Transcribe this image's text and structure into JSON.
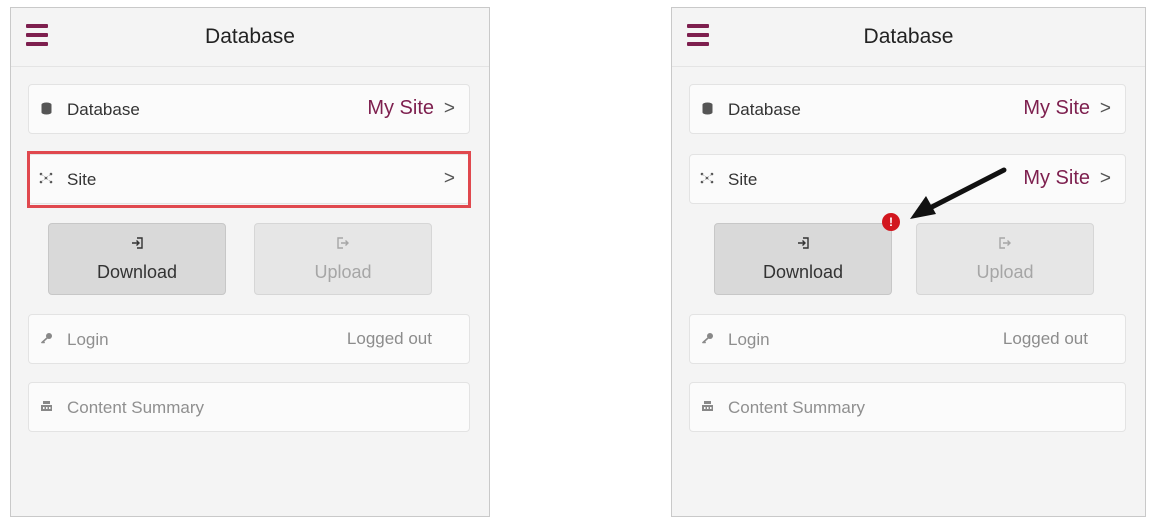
{
  "screens": [
    {
      "header": {
        "title": "Database"
      },
      "database_row": {
        "icon": "database-icon",
        "label": "Database",
        "value": "My Site"
      },
      "site_row": {
        "icon": "site-icon",
        "label": "Site",
        "value": ""
      },
      "download_button": {
        "icon": "download-icon",
        "label": "Download"
      },
      "upload_button": {
        "icon": "upload-icon",
        "label": "Upload"
      },
      "login_row": {
        "icon": "key-icon",
        "label": "Login",
        "value": "Logged out"
      },
      "summary_row": {
        "icon": "summary-icon",
        "label": "Content Summary"
      }
    },
    {
      "header": {
        "title": "Database"
      },
      "database_row": {
        "icon": "database-icon",
        "label": "Database",
        "value": "My Site"
      },
      "site_row": {
        "icon": "site-icon",
        "label": "Site",
        "value": "My Site"
      },
      "download_button": {
        "icon": "download-icon",
        "label": "Download",
        "badge": "!"
      },
      "upload_button": {
        "icon": "upload-icon",
        "label": "Upload"
      },
      "login_row": {
        "icon": "key-icon",
        "label": "Login",
        "value": "Logged out"
      },
      "summary_row": {
        "icon": "summary-icon",
        "label": "Content Summary"
      }
    }
  ],
  "colors": {
    "accent": "#7d1f4e",
    "highlight": "#e0484e",
    "badge": "#d2161e",
    "background": "#f4f4f4"
  }
}
